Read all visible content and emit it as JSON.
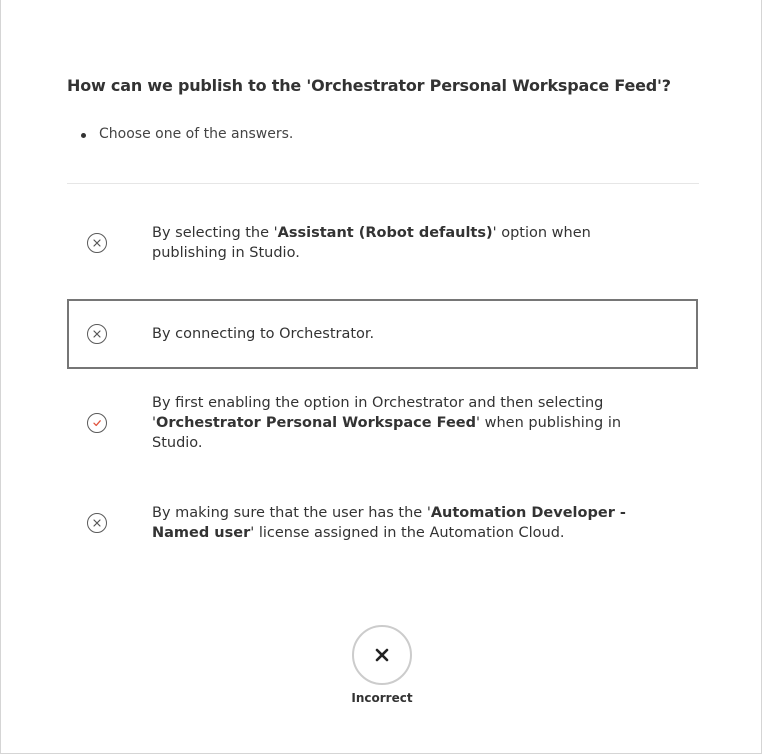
{
  "question": {
    "title": "How can we publish to the 'Orchestrator Personal Workspace Feed'?",
    "instruction": "Choose one of the answers."
  },
  "answers": [
    {
      "status": "incorrect-icon",
      "selected": false,
      "pre": "By selecting the '",
      "bold": "Assistant (Robot defaults)",
      "post": "' option when publishing in Studio."
    },
    {
      "status": "incorrect-icon",
      "selected": true,
      "pre": "By connecting to Orchestrator.",
      "bold": "",
      "post": ""
    },
    {
      "status": "correct-icon",
      "selected": false,
      "pre": "By first enabling the option in Orchestrator and then selecting '",
      "bold": "Orchestrator Personal Workspace Feed",
      "post": "' when publishing in Studio."
    },
    {
      "status": "incorrect-icon",
      "selected": false,
      "pre": "By making sure that the user has the '",
      "bold": "Automation Developer - Named user",
      "post": "' license assigned in the Automation Cloud."
    }
  ],
  "result": {
    "icon": "close-icon",
    "label": "Incorrect"
  },
  "colors": {
    "correct": "#e0533d",
    "incorrect": "#555555",
    "selected_border": "#767676"
  }
}
